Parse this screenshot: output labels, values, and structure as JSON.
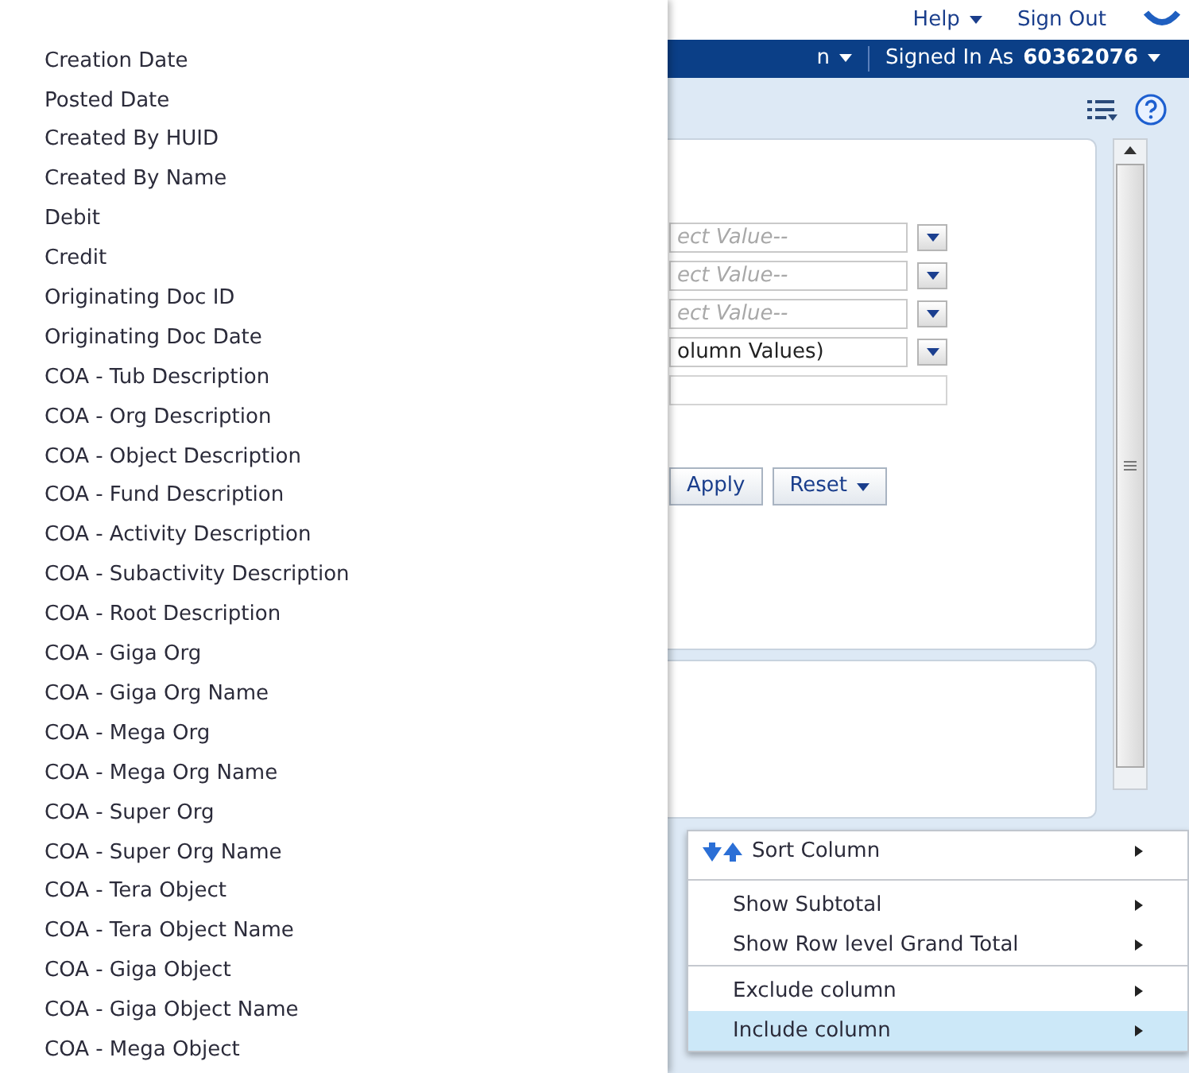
{
  "header": {
    "help": "Help",
    "sign_out": "Sign Out"
  },
  "nav": {
    "menu_cut": "n",
    "signed_in_label": "Signed In As",
    "user_id": "60362076"
  },
  "filters": [
    {
      "kind": "select",
      "placeholder": "ect Value--"
    },
    {
      "kind": "select",
      "placeholder": "ect Value--"
    },
    {
      "kind": "select",
      "placeholder": "ect Value--"
    },
    {
      "kind": "select",
      "value": "olumn Values)"
    },
    {
      "kind": "text"
    }
  ],
  "buttons": [
    {
      "label": "Apply",
      "kind": "plain"
    },
    {
      "label": "Reset",
      "kind": "dropdown"
    }
  ],
  "column_list": [
    "Creation Date",
    "Posted Date",
    "Created By HUID",
    "Created By Name",
    "Debit",
    "Credit",
    "Originating Doc ID",
    "Originating Doc Date",
    "COA - Tub Description",
    "COA - Org Description",
    "COA - Object Description",
    "COA - Fund Description",
    "COA - Activity Description",
    "COA - Subactivity Description",
    "COA - Root Description",
    "COA - Giga Org",
    "COA - Giga Org Name",
    "COA - Mega Org",
    "COA - Mega Org Name",
    "COA - Super Org",
    "COA - Super Org Name",
    "COA - Tera Object",
    "COA - Tera Object Name",
    "COA - Giga Object",
    "COA - Giga Object Name",
    "COA - Mega Object"
  ],
  "context_menu": [
    [
      {
        "label": "Sort Column",
        "kind": "sort",
        "selected": false
      }
    ],
    [
      {
        "label": "Show Subtotal",
        "kind": "plain",
        "selected": false
      },
      {
        "label": "Show Row level Grand Total",
        "kind": "plain",
        "selected": false
      }
    ],
    [
      {
        "label": "Exclude column",
        "kind": "plain",
        "selected": false
      },
      {
        "label": "Include column",
        "kind": "plain",
        "selected": true
      }
    ]
  ]
}
